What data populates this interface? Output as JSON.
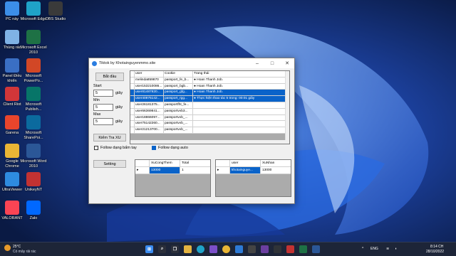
{
  "desktop": {
    "icons": [
      {
        "label": "PC này",
        "icon": "computer-icon",
        "color": "#3c8ee8"
      },
      {
        "label": "Microsoft Edge",
        "icon": "edge-icon",
        "color": "#1fa3c8"
      },
      {
        "label": "OBS Studio",
        "icon": "obs-icon",
        "color": "#3a3a3a"
      },
      {
        "label": "Thùng rác",
        "icon": "recycle-bin-icon",
        "color": "#7fb2e5"
      },
      {
        "label": "Microsoft Excel 2010",
        "icon": "excel-icon",
        "color": "#1e7145"
      },
      {
        "label": "Panel Điều khiển",
        "icon": "control-panel-icon",
        "color": "#3a6fc4"
      },
      {
        "label": "Microsoft PowerPo...",
        "icon": "powerpoint-icon",
        "color": "#d24726"
      },
      {
        "label": "Client Riot",
        "icon": "riot-icon",
        "color": "#d13639"
      },
      {
        "label": "Microsoft Publish...",
        "icon": "publisher-icon",
        "color": "#077568"
      },
      {
        "label": "Garena",
        "icon": "garena-icon",
        "color": "#e8452c"
      },
      {
        "label": "Microsoft SharePoi...",
        "icon": "sharepoint-icon",
        "color": "#0b6a9e"
      },
      {
        "label": "Google Chrome",
        "icon": "chrome-icon",
        "color": "#e9b535"
      },
      {
        "label": "Microsoft Word 2010",
        "icon": "word-icon",
        "color": "#2b5797"
      },
      {
        "label": "UltraViewer",
        "icon": "ultraviewer-icon",
        "color": "#2e8be0"
      },
      {
        "label": "UnikeyNT",
        "icon": "unikey-icon",
        "color": "#c23232"
      },
      {
        "label": "VALORANT",
        "icon": "valorant-icon",
        "color": "#fa4454"
      },
      {
        "label": "Zalo",
        "icon": "zalo-icon",
        "color": "#0068ff"
      }
    ]
  },
  "window": {
    "title": "Tiktok by Khotainguyenmmo.site",
    "start_button": "Bắt đầu",
    "start_label": "Start",
    "start_value": "5",
    "min_label": "Min",
    "min_value": "5",
    "max_label": "Max",
    "max_value": "5",
    "unit": "giây",
    "check_xu_button": "Kiểm Tra XU",
    "follow_manual_label": "Follow dạng bấm tay",
    "follow_auto_label": "Follow dạng auto",
    "setting_button": "Setting",
    "grid": {
      "columns": [
        "user",
        "Cookie",
        "Trang thái"
      ],
      "rows": [
        {
          "user": "melinda859870",
          "cookie": "passport_fe_b...",
          "status": "● Hoan Thanh Job.",
          "selected": false
        },
        {
          "user": "user153210086...",
          "cookie": "passport_bgb...",
          "status": "● Hoan Thanh Job.",
          "selected": false
        },
        {
          "user": "user81487820...",
          "cookie": "passport_gfg...",
          "status": "● Hoan Thanh Job.",
          "selected": true
        },
        {
          "user": "user40875142...",
          "cookie": "passport_rgg...",
          "status": "● Thực hiện thao tác 5 trong:  00:01 giây",
          "selected": true
        },
        {
          "user": "user26181375...",
          "cookie": "passportfht_fe...",
          "status": "",
          "selected": false
        },
        {
          "user": "user66369841...",
          "cookie": "passportvvb3...",
          "status": "",
          "selected": false
        },
        {
          "user": "user18866097...",
          "cookie": "passportvvb_...",
          "status": "",
          "selected": false
        },
        {
          "user": "user75142260...",
          "cookie": "passportvvb_...",
          "status": "",
          "selected": false
        },
        {
          "user": "user21213700...",
          "cookie": "passportvvb_...",
          "status": "",
          "selected": false
        }
      ]
    },
    "coin_grid": {
      "columns": [
        "XuCongThem",
        "Total"
      ],
      "row": {
        "marker": "▸",
        "xu": "13000",
        "total": "1"
      }
    },
    "user_grid": {
      "columns": [
        "user",
        "XuNhan"
      ],
      "row": {
        "marker": "▸",
        "user": "khotainguye...",
        "xu": "13000"
      }
    }
  },
  "taskbar": {
    "weather_temp": "25°C",
    "weather_desc": "Có mây rải rác",
    "language": "ENG",
    "time": "8:14 CH",
    "date": "28/10/2022"
  }
}
